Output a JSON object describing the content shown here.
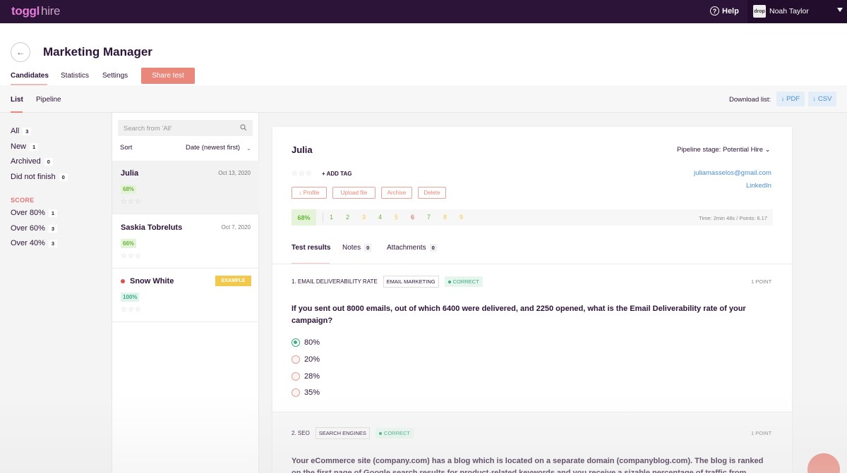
{
  "topbar": {
    "logo": "toggl",
    "logo_suffix": "hire",
    "help_label": "Help",
    "help_icon": "?",
    "avatar_text": "drop",
    "user_name": "Noah Taylor"
  },
  "header": {
    "title": "Marketing Manager",
    "tabs": [
      "Candidates",
      "Statistics",
      "Settings"
    ],
    "share_label": "Share test"
  },
  "subheader": {
    "tabs": [
      "List",
      "Pipeline"
    ],
    "download_label": "Download list:",
    "pdf_label": "↓ PDF",
    "csv_label": "↓ CSV"
  },
  "filters": {
    "items": [
      {
        "label": "All",
        "count": "3"
      },
      {
        "label": "New",
        "count": "1"
      },
      {
        "label": "Archived",
        "count": "0"
      },
      {
        "label": "Did not finish",
        "count": "0"
      }
    ],
    "score_heading": "SCORE",
    "score_items": [
      {
        "label": "Over 80%",
        "count": "1"
      },
      {
        "label": "Over 60%",
        "count": "3"
      },
      {
        "label": "Over 40%",
        "count": "3"
      }
    ]
  },
  "candidates": {
    "search_placeholder": "Search from 'All'",
    "sort_label": "Sort",
    "sort_value": "Date (newest first)",
    "list": [
      {
        "name": "Julia",
        "date": "Oct 13, 2020",
        "score": "68%"
      },
      {
        "name": "Saskia Tobreluts",
        "date": "Oct 7, 2020",
        "score": "66%"
      },
      {
        "name": "Snow White",
        "badge": "EXAMPLE",
        "score": "100%"
      }
    ]
  },
  "detail": {
    "name": "Julia",
    "pipeline": "Pipeline stage: Potential Hire",
    "add_tag": "+ ADD TAG",
    "email": "juliamasselos@gmail.com",
    "linkedin": "LinkedIn",
    "actions": [
      "↓ Profile",
      "Upload file",
      "Archive",
      "Delete"
    ],
    "score": "68%",
    "question_numbers": [
      "1",
      "2",
      "3",
      "4",
      "5",
      "6",
      "7",
      "8",
      "9"
    ],
    "time_points": "Time: 2min 48s / Points: 6.17",
    "tabs": [
      {
        "label": "Test results"
      },
      {
        "label": "Notes",
        "count": "0"
      },
      {
        "label": "Attachments",
        "count": "0"
      }
    ],
    "q1": {
      "title": "1. EMAIL DELIVERABILITY RATE",
      "tag": "EMAIL MARKETING",
      "status": "CORRECT",
      "points": "1 POINT",
      "text": "If you sent out 8000 emails, out of which 6400 were delivered, and 2250 opened, what is the Email Deliverability rate of your campaign?",
      "options": [
        "80%",
        "20%",
        "28%",
        "35%"
      ]
    },
    "q2": {
      "title": "2. SEO",
      "tag": "SEARCH ENGINES",
      "status": "CORRECT",
      "points": "1 POINT",
      "text": "Your eCommerce site (company.com) has a blog which is located on a separate domain (companyblog.com). The blog is ranked on the first page of Google search results for product-related keywords and you receive a sizable percentage of traffic from these"
    }
  },
  "colors": {
    "topbar": "#2c1338",
    "accent": "#e8877a",
    "link": "#4a8fd0",
    "correct": "#3daa80"
  },
  "qnum_colors": [
    "#6bb33f",
    "#6bb33f",
    "#f2c94c",
    "#6bb33f",
    "#f2c94c",
    "#d9534f",
    "#6bb33f",
    "#f2c94c",
    "#f2c94c"
  ]
}
